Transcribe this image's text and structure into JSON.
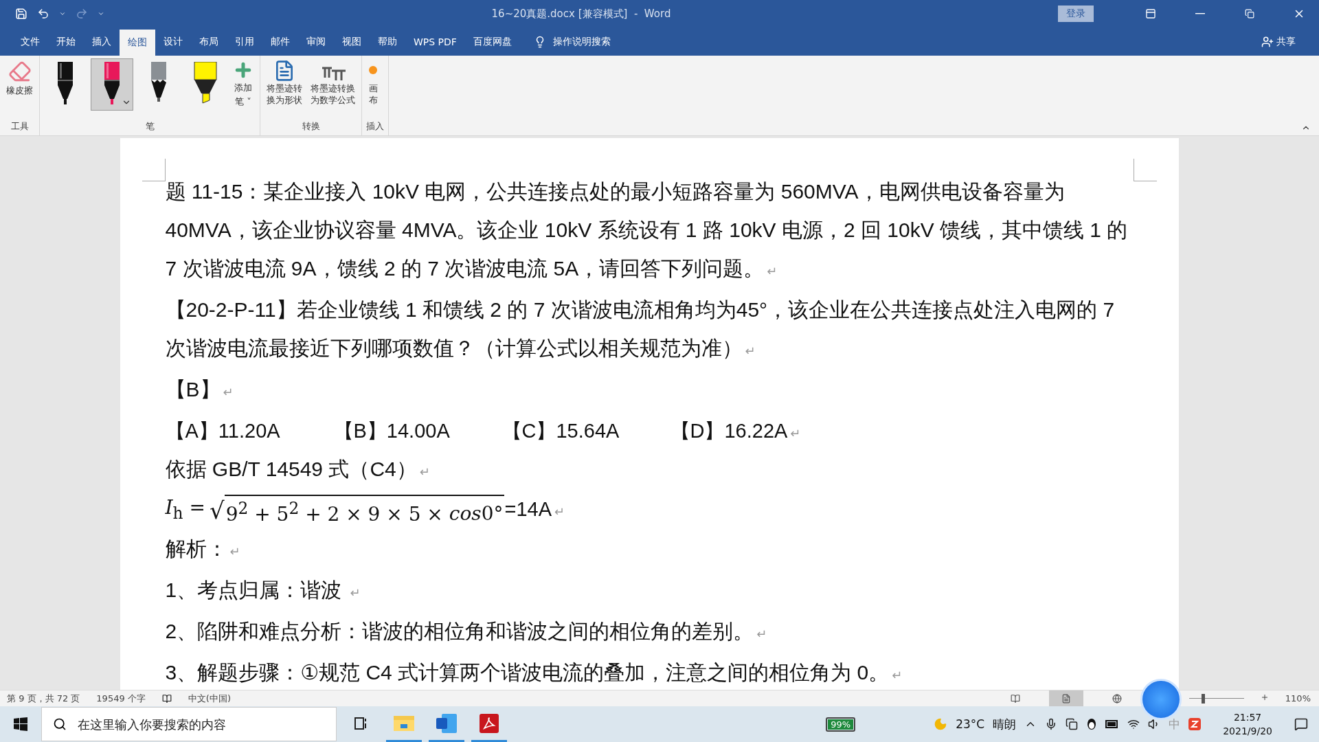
{
  "title_bar": {
    "title": "16~20真题.docx [兼容模式]  -  Word",
    "sign_in": "登录"
  },
  "menu_tabs": [
    {
      "label": "文件",
      "selected": false
    },
    {
      "label": "开始",
      "selected": false
    },
    {
      "label": "插入",
      "selected": false
    },
    {
      "label": "绘图",
      "selected": true
    },
    {
      "label": "设计",
      "selected": false
    },
    {
      "label": "布局",
      "selected": false
    },
    {
      "label": "引用",
      "selected": false
    },
    {
      "label": "邮件",
      "selected": false
    },
    {
      "label": "审阅",
      "selected": false
    },
    {
      "label": "视图",
      "selected": false
    },
    {
      "label": "帮助",
      "selected": false
    },
    {
      "label": "WPS PDF",
      "selected": false
    },
    {
      "label": "百度网盘",
      "selected": false
    }
  ],
  "tell_me": "操作说明搜索",
  "share": "共享",
  "ribbon": {
    "eraser": "橡皮擦",
    "tools_group": "工具",
    "pens": [
      {
        "kind": "pen",
        "color": "#111111",
        "selected": false
      },
      {
        "kind": "pen",
        "color": "#e8185a",
        "selected": true
      },
      {
        "kind": "pencil",
        "color": "#8a8f94",
        "selected": false
      },
      {
        "kind": "highlighter",
        "color": "#fff200",
        "selected": false
      }
    ],
    "add_pen": [
      "添加",
      "笔",
      "˅"
    ],
    "pens_group": "笔",
    "convert": [
      "将墨迹转换为形状",
      "将墨迹转换为数学公式"
    ],
    "convert_group": "转换",
    "canvas": "画布",
    "insert_group": "插入"
  },
  "document": [
    {
      "kind": "text",
      "text": "题 11-15：某企业接入 10kV 电网，公共连接点处的最小短路容量为 560MVA，电网供电设备容量为 40MVA，该企业协议容量 4MVA。该企业 10kV 系统设有 1 路 10kV 电源，2 回 10kV 馈线，其中馈线 1 的 7 次谐波电流 9A，馈线 2 的 7 次谐波电流 5A，请回答下列问题。",
      "mark": "↵"
    },
    {
      "kind": "text",
      "text": "【20-2-P-11】若企业馈线 1 和馈线 2 的 7 次谐波电流相角均为45°，该企业在公共连接点处注入电网的 7 次谐波电流最接近下列哪项数值？（计算公式以相关规范为准）",
      "mark": "↵"
    },
    {
      "kind": "text",
      "text": "【B】",
      "mark": "↵"
    },
    {
      "kind": "options",
      "options": [
        "【A】11.20A",
        "【B】14.00A",
        "【C】15.64A",
        "【D】16.22A"
      ],
      "mark": "↵"
    },
    {
      "kind": "text",
      "text": "依据 GB/T 14549  式（C4）",
      "mark": "↵"
    },
    {
      "kind": "formula",
      "lhs": "*I*$_{h}$ =",
      "root_sign": "√",
      "radicand": "9$^{2}$ + 5$^{2}$ + 2 × 9 × 5 × ",
      "function": "cos",
      "argument": "0°",
      "result": "=14A",
      "mark": "↵"
    },
    {
      "kind": "text",
      "text": "解析：",
      "mark": "↵"
    },
    {
      "kind": "text",
      "text": "1、考点归属：谐波 ",
      "mark": "↵"
    },
    {
      "kind": "text",
      "text": "2、陷阱和难点分析：谐波的相位角和谐波之间的相位角的差别。",
      "mark": "↵"
    },
    {
      "kind": "text",
      "text": "3、解题步骤：①规范 C4 式计算两个谐波电流的叠加，注意之间的相位角为 0。",
      "mark": "↵"
    }
  ],
  "status_bar": {
    "page": "第 9 页，共 72 页",
    "words": "19549 个字",
    "language": "中文(中国)",
    "views": [
      {
        "kind": "read",
        "selected": false
      },
      {
        "kind": "print",
        "selected": true
      },
      {
        "kind": "web",
        "selected": false
      }
    ],
    "zoom": {
      "level": 0.23,
      "reading": "110%"
    }
  },
  "taskbar": {
    "search_placeholder": "在这里输入你要搜索的内容",
    "apps": [
      {
        "kind": "explorer",
        "running": true
      },
      {
        "kind": "word",
        "running": true
      },
      {
        "kind": "pdf",
        "running": true
      }
    ],
    "battery": "99%",
    "temperature": "23°C",
    "weather": "晴朗",
    "ime": "中",
    "time": "21:57",
    "date": "2021/9/20"
  }
}
